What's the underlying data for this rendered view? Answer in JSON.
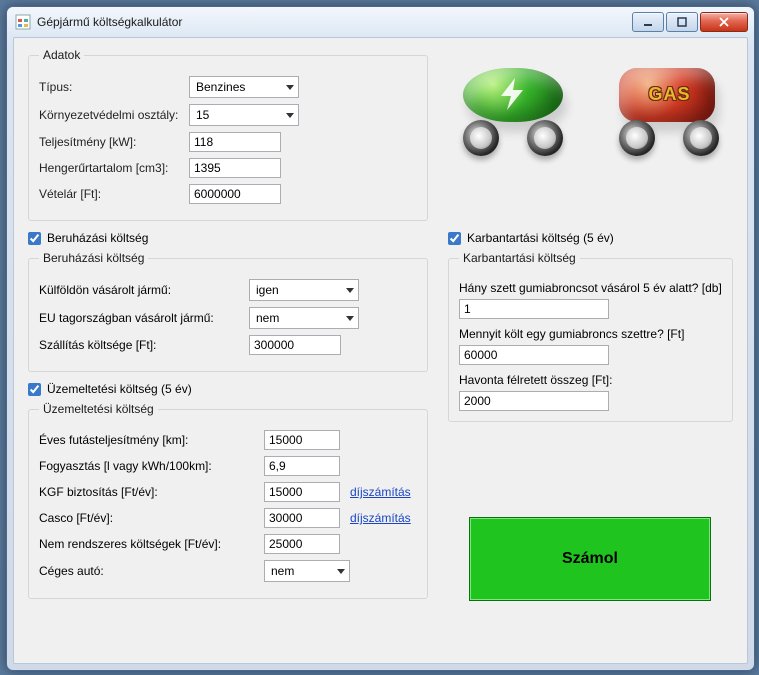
{
  "window": {
    "title": "Gépjármű költségkalkulátor"
  },
  "adatok": {
    "legend": "Adatok",
    "tipus_label": "Típus:",
    "tipus_value": "Benzines",
    "korny_label": "Környezetvédelmi osztály:",
    "korny_value": "15",
    "telj_label": "Teljesítmény [kW]:",
    "telj_value": "118",
    "henger_label": "Hengerűrtartalom [cm3]:",
    "henger_value": "1395",
    "vetelar_label": "Vételár [Ft]:",
    "vetelar_value": "6000000"
  },
  "sections": {
    "beruhazas_chk": "Beruházási költség",
    "uzemeltetes_chk": "Üzemeltetési költség (5 év)",
    "karbantartas_chk": "Karbantartási költség (5 év)"
  },
  "beruhazas": {
    "legend": "Beruházási költség",
    "kulfold_label": "Külföldön vásárolt jármű:",
    "kulfold_value": "igen",
    "eu_label": "EU tagországban vásárolt jármű:",
    "eu_value": "nem",
    "szallitas_label": "Szállítás költsége [Ft]:",
    "szallitas_value": "300000"
  },
  "uzemeltetes": {
    "legend": "Üzemeltetési költség",
    "eves_label": "Éves futásteljesítmény [km]:",
    "eves_value": "15000",
    "fogy_label": "Fogyasztás [l vagy kWh/100km]:",
    "fogy_value": "6,9",
    "kgf_label": "KGF biztosítás [Ft/év]:",
    "kgf_value": "15000",
    "casco_label": "Casco [Ft/év]:",
    "casco_value": "30000",
    "nemrend_label": "Nem rendszeres költségek [Ft/év]:",
    "nemrend_value": "25000",
    "ceges_label": "Céges autó:",
    "ceges_value": "nem",
    "dij_link": "díjszámítás"
  },
  "karbantartas": {
    "legend": "Karbantartási költség",
    "gumi_db_label": "Hány szett gumiabroncsot vásárol 5 év alatt? [db]",
    "gumi_db_value": "1",
    "gumi_ft_label": "Mennyit költ egy gumiabroncs szettre? [Ft]",
    "gumi_ft_value": "60000",
    "havonta_label": "Havonta félretett összeg [Ft]:",
    "havonta_value": "2000"
  },
  "gas_text": "GAS",
  "calc_button": "Számol"
}
